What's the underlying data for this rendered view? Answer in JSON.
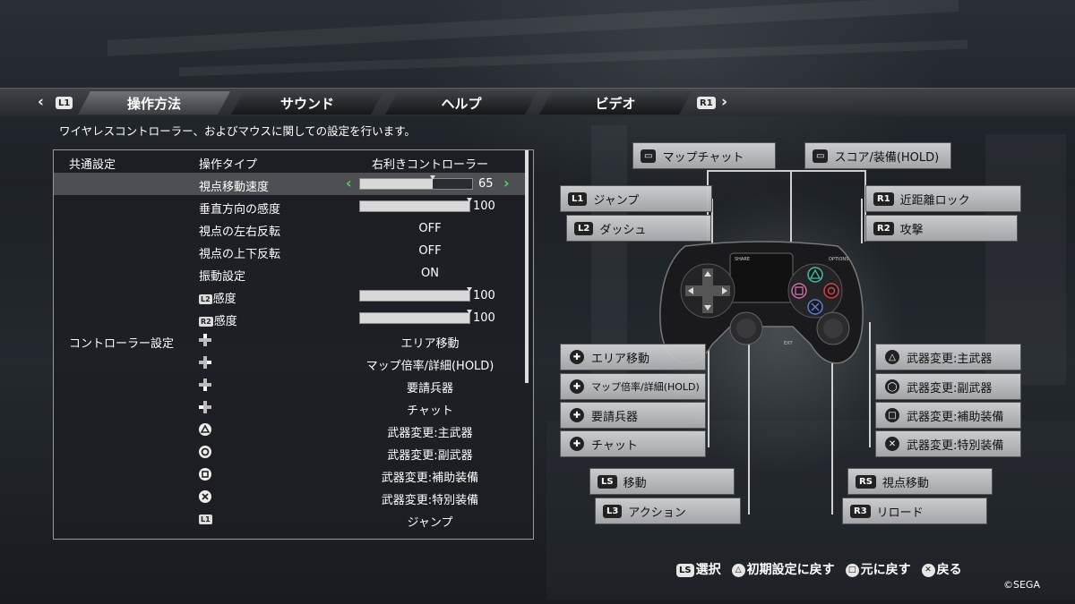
{
  "tabs": {
    "left_trigger": "L1",
    "right_trigger": "R1",
    "items": [
      "操作方法",
      "サウンド",
      "ヘルプ",
      "ビデオ"
    ],
    "active": "操作方法"
  },
  "description": "ワイヤレスコントローラー、およびマウスに関しての設定を行います。",
  "settings": {
    "header": {
      "category": "共通設定",
      "name": "操作タイプ",
      "value": "右利きコントローラー"
    },
    "camera_speed": {
      "name": "視点移動速度",
      "value": "65",
      "level": 65
    },
    "vertical_sens": {
      "name": "垂直方向の感度",
      "value": "100",
      "level": 100
    },
    "invert_h": {
      "name": "視点の左右反転",
      "value": "OFF"
    },
    "invert_v": {
      "name": "視点の上下反転",
      "value": "OFF"
    },
    "vibration": {
      "name": "振動設定",
      "value": "ON"
    },
    "l2_sens": {
      "chip": "L2",
      "name": "感度",
      "value": "100",
      "level": 100
    },
    "r2_sens": {
      "chip": "R2",
      "name": "感度",
      "value": "100",
      "level": 100
    },
    "controller_category": "コントローラー設定",
    "bindings": [
      {
        "icon": "dpad-up-icon",
        "value": "エリア移動"
      },
      {
        "icon": "dpad-right-icon",
        "value": "マップ倍率/詳細(HOLD)"
      },
      {
        "icon": "dpad-down-icon",
        "value": "要請兵器"
      },
      {
        "icon": "dpad-left-icon",
        "value": "チャット"
      },
      {
        "icon": "triangle-icon",
        "value": "武器変更:主武器"
      },
      {
        "icon": "circle-icon",
        "value": "武器変更:副武器"
      },
      {
        "icon": "square-icon",
        "value": "武器変更:補助装備"
      },
      {
        "icon": "cross-icon",
        "value": "武器変更:特別装備"
      },
      {
        "icon": "L1",
        "value": "ジャンプ"
      }
    ]
  },
  "callouts": {
    "share": "マップチャット",
    "options": "スコア/装備(HOLD)",
    "l1": {
      "tag": "L1",
      "label": "ジャンプ"
    },
    "l2": {
      "tag": "L2",
      "label": "ダッシュ"
    },
    "r1": {
      "tag": "R1",
      "label": "近距離ロック"
    },
    "r2": {
      "tag": "R2",
      "label": "攻撃"
    },
    "dpad_up": "エリア移動",
    "dpad_right": "マップ倍率/詳細(HOLD)",
    "dpad_down": "要請兵器",
    "dpad_left": "チャット",
    "triangle": "武器変更:主武器",
    "circle": "武器変更:副武器",
    "square": "武器変更:補助装備",
    "cross": "武器変更:特別装備",
    "ls": {
      "tag": "LS",
      "label": "移動"
    },
    "l3": {
      "tag": "L3",
      "label": "アクション"
    },
    "rs": {
      "tag": "RS",
      "label": "視点移動"
    },
    "r3": {
      "tag": "R3",
      "label": "リロード"
    }
  },
  "controller_labels": {
    "share": "SHARE",
    "options": "OPTIONS",
    "ext": "EXT"
  },
  "footer": {
    "select": {
      "tag": "LS",
      "label": "選択"
    },
    "reset": {
      "label": "初期設定に戻す"
    },
    "revert": {
      "label": "元に戻す"
    },
    "back": {
      "label": "戻る"
    }
  },
  "copyright": "©SEGA",
  "colors": {
    "accent_green": "#4cd26a",
    "panel_border": "#9a9a9a",
    "ps_blue": "#5a7fd0",
    "ps_red": "#d0404a",
    "ps_pink": "#d070a8",
    "ps_green": "#3ec0a0"
  }
}
